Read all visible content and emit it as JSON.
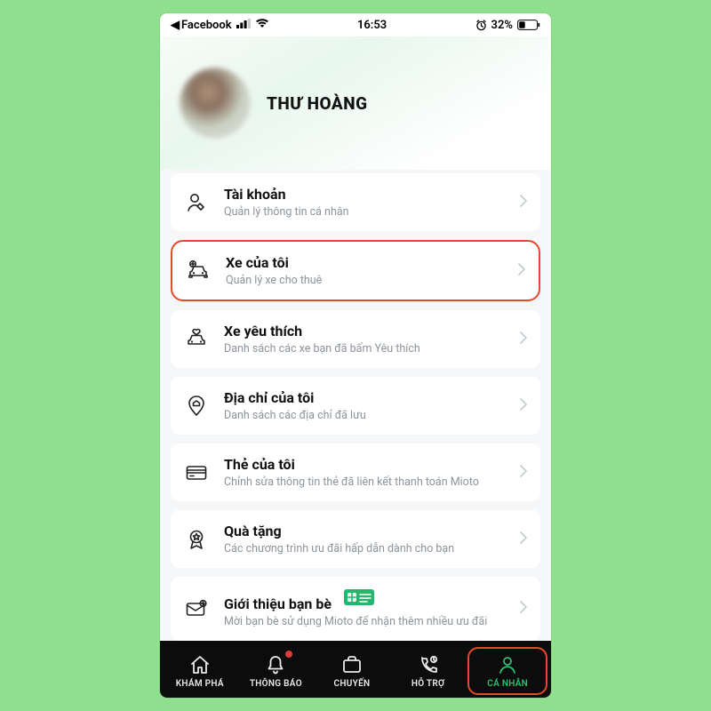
{
  "statusbar": {
    "carrier_back": "Facebook",
    "time": "16:53",
    "battery_pct": "32%"
  },
  "profile": {
    "name": "THƯ HOÀNG"
  },
  "menu": [
    {
      "title": "Tài khoản",
      "sub": "Quản lý thông tin cá nhân"
    },
    {
      "title": "Xe của tôi",
      "sub": "Quản lý xe cho thuê"
    },
    {
      "title": "Xe yêu thích",
      "sub": "Danh sách các xe bạn đã bấm Yêu thích"
    },
    {
      "title": "Địa chỉ của tôi",
      "sub": "Danh sách các địa chỉ đã lưu"
    },
    {
      "title": "Thẻ của tôi",
      "sub": "Chỉnh sửa thông tin thẻ đã liên kết thanh toán Mioto"
    },
    {
      "title": "Quà tặng",
      "sub": "Các chương trình ưu đãi hấp dẫn dành cho bạn"
    },
    {
      "title": "Giới thiệu bạn bè",
      "sub": "Mời bạn bè sử dụng Mioto để nhận thêm nhiều ưu đãi"
    }
  ],
  "tabs": {
    "explore": "KHÁM PHÁ",
    "notify": "THÔNG BÁO",
    "trips": "CHUYẾN",
    "support": "HỖ TRỢ",
    "profile": "CÁ NHÂN"
  }
}
